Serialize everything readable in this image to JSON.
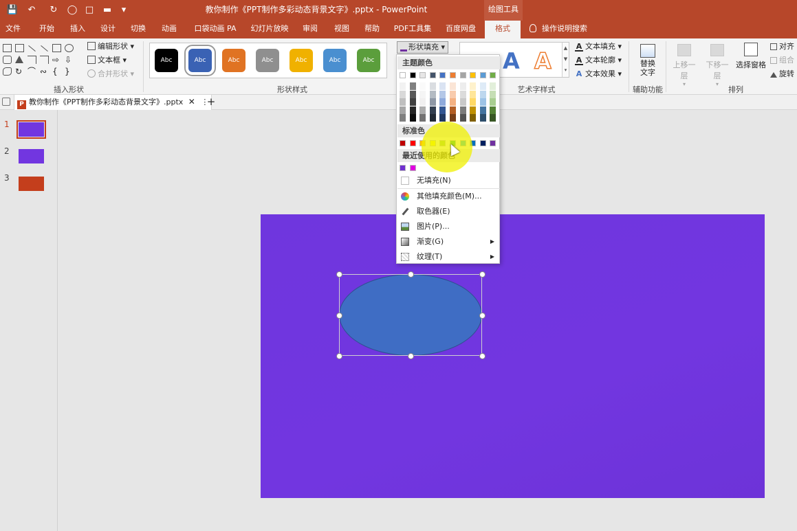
{
  "window": {
    "title": "教你制作《PPT制作多彩动态背景文字》.pptx  -  PowerPoint",
    "contextual_tab": "绘图工具"
  },
  "tabs": [
    {
      "label": "文件"
    },
    {
      "label": "开始"
    },
    {
      "label": "插入"
    },
    {
      "label": "设计"
    },
    {
      "label": "切换"
    },
    {
      "label": "动画"
    },
    {
      "label": "口袋动画 PA"
    },
    {
      "label": "幻灯片放映"
    },
    {
      "label": "审阅"
    },
    {
      "label": "视图"
    },
    {
      "label": "帮助"
    },
    {
      "label": "PDF工具集"
    },
    {
      "label": "百度网盘"
    },
    {
      "label": "格式"
    }
  ],
  "tell_me": "操作说明搜索",
  "ribbon": {
    "insert_shapes": {
      "label": "插入形状",
      "edit_shape": "编辑形状",
      "text_box": "文本框",
      "merge_shapes": "合并形状"
    },
    "shape_styles": {
      "label": "形状样式",
      "swatch_text": "Abc",
      "swatch_colors": [
        "#000000",
        "#3a62b4",
        "#e07323",
        "#8f8f8f",
        "#f0b100",
        "#4a8fd0",
        "#5b9e3c"
      ],
      "fill_button": "形状填充"
    },
    "wordart": {
      "label": "艺术字样式",
      "text_fill": "文本填充",
      "text_outline": "文本轮廓",
      "text_effects": "文本效果",
      "letter": "A"
    },
    "accessibility": {
      "label": "辅助功能",
      "alt_text_line1": "替换",
      "alt_text_line2": "文字"
    },
    "arrange": {
      "label": "排列",
      "bring_forward": "上移一层",
      "send_backward": "下移一层",
      "selection_pane": "选择窗格",
      "align": "对齐",
      "group": "组合",
      "rotate": "旋转"
    }
  },
  "document_tab": {
    "filename": "教你制作《PPT制作多彩动态背景文字》.pptx",
    "icon_letter": "P"
  },
  "thumbnails": [
    {
      "number": "1",
      "color": "#7236e0"
    },
    {
      "number": "2",
      "color": "#7236e0"
    },
    {
      "number": "3",
      "color": "#c43e1c"
    }
  ],
  "dropdown": {
    "theme_colors_header": "主题颜色",
    "theme_colors": [
      "#ffffff",
      "#000000",
      "#e7e6e6",
      "#44546a",
      "#4472c4",
      "#ed7d31",
      "#a5a5a5",
      "#ffc000",
      "#5b9bd5",
      "#70ad47"
    ],
    "standard_colors_header": "标准色",
    "standard_colors": [
      "#c00000",
      "#ff0000",
      "#ffc000",
      "#ffff00",
      "#92d050",
      "#00b050",
      "#00b0f0",
      "#0070c0",
      "#002060",
      "#7030a0"
    ],
    "recent_colors_header": "最近使用的颜色",
    "recent_colors": [
      "#7030d0",
      "#e000e0"
    ],
    "items": [
      {
        "label": "无填充(N)",
        "icon": "no-fill-icon"
      },
      {
        "label": "其他填充颜色(M)...",
        "icon": "color-wheel-icon"
      },
      {
        "label": "取色器(E)",
        "icon": "eyedropper-icon"
      },
      {
        "label": "图片(P)...",
        "icon": "picture-icon"
      },
      {
        "label": "渐变(G)",
        "icon": "gradient-icon",
        "submenu": true
      },
      {
        "label": "纹理(T)",
        "icon": "texture-icon",
        "submenu": true
      }
    ]
  },
  "slide": {
    "background_color": "#7236e0",
    "shape_fill": "#3f6dc4"
  }
}
